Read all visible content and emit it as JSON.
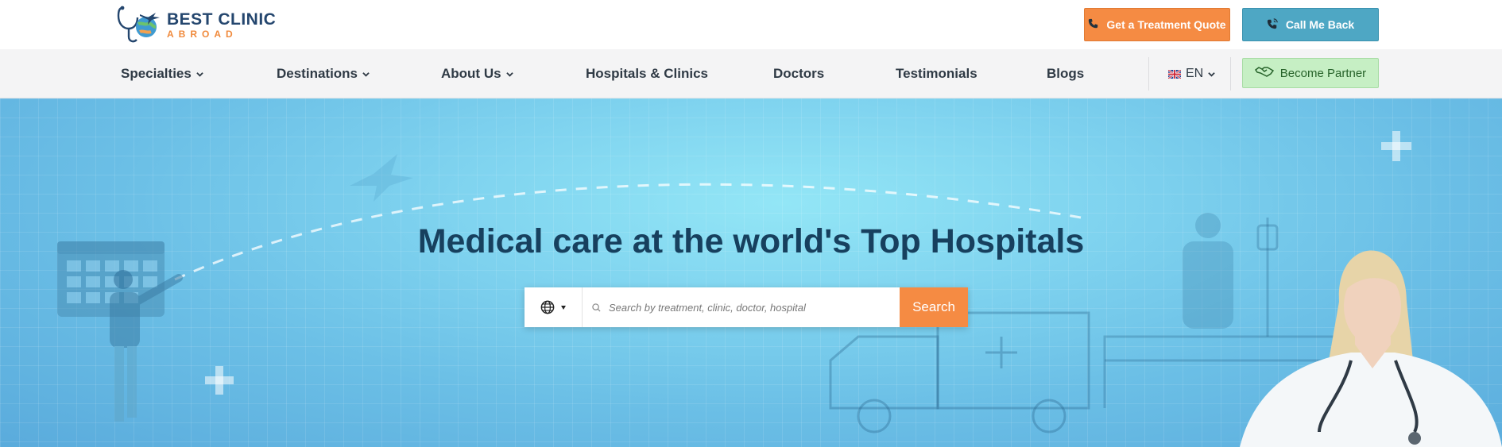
{
  "brand": {
    "name_line1": "BEST CLINIC",
    "name_line2": "ABROAD",
    "colors": {
      "navy": "#24466e",
      "orange": "#f08a3c",
      "teal": "#4ea7c4"
    }
  },
  "header": {
    "quote_button": {
      "label": "Get a Treatment Quote",
      "icon": "phone-icon"
    },
    "callback_button": {
      "label": "Call Me Back",
      "icon": "phone-ring-icon"
    }
  },
  "nav": {
    "items": [
      {
        "label": "Specialties",
        "has_dropdown": true
      },
      {
        "label": "Destinations",
        "has_dropdown": true
      },
      {
        "label": "About Us",
        "has_dropdown": true
      },
      {
        "label": "Hospitals & Clinics",
        "has_dropdown": false
      },
      {
        "label": "Doctors",
        "has_dropdown": false
      },
      {
        "label": "Testimonials",
        "has_dropdown": false
      },
      {
        "label": "Blogs",
        "has_dropdown": false
      }
    ],
    "language": {
      "label": "EN",
      "flag": "uk-flag-icon"
    },
    "partner_button": {
      "label": "Become Partner",
      "icon": "handshake-icon"
    }
  },
  "hero": {
    "title": "Medical care at the world's Top Hospitals",
    "search": {
      "placeholder": "Search by treatment, clinic, doctor, hospital",
      "button_label": "Search",
      "region_icon": "globe-icon"
    }
  }
}
